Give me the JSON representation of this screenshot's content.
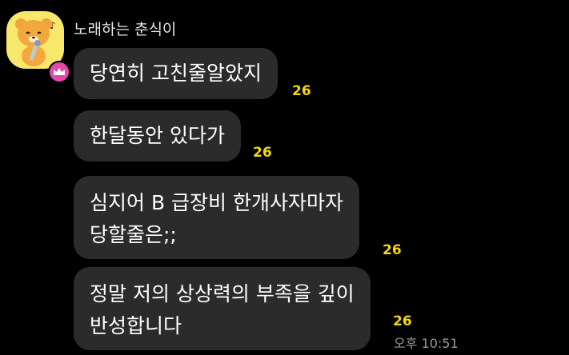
{
  "chat": {
    "sender_name": "노래하는 춘식이",
    "messages": [
      {
        "lines": [
          "당연히 고친줄알았지"
        ],
        "unread_count": "26"
      },
      {
        "lines": [
          "한달동안 있다가"
        ],
        "unread_count": "26"
      },
      {
        "lines": [
          "심지어 B 급장비 한개사자마자",
          "당할줄은;;"
        ],
        "unread_count": "26"
      },
      {
        "lines": [
          "정말 저의 상상력의 부족을 깊이",
          "반성합니다"
        ],
        "unread_count": "26"
      }
    ],
    "timestamp": "오후 10:51"
  },
  "colors": {
    "background": "#000000",
    "bubble": "#2b2b2b",
    "unread": "#f5d90a",
    "badge": "#e24aa8",
    "avatar_bg": "#f7e76a"
  },
  "icons": {
    "avatar": "character-avatar-icon",
    "badge": "crown-icon"
  }
}
